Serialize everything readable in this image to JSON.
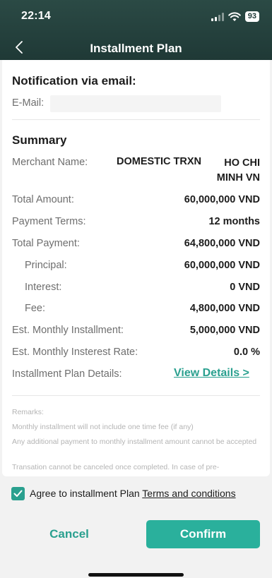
{
  "status_bar": {
    "time": "22:14",
    "battery": "93"
  },
  "header": {
    "title": "Installment Plan"
  },
  "notification": {
    "title": "Notification via email:",
    "email_label": "E-Mail:",
    "email_value": ""
  },
  "summary": {
    "title": "Summary",
    "merchant_label": "Merchant Name:",
    "merchant_value_a": "DOMESTIC TRXN",
    "merchant_value_b": "HO CHI MINH  VN",
    "rows": [
      {
        "label": "Total Amount:",
        "value": "60,000,000 VND"
      },
      {
        "label": "Payment Terms:",
        "value": "12 months"
      },
      {
        "label": "Total Payment:",
        "value": "64,800,000 VND"
      },
      {
        "label": "Principal:",
        "value": "60,000,000 VND"
      },
      {
        "label": "Interest:",
        "value": "0 VND"
      },
      {
        "label": "Fee:",
        "value": "4,800,000 VND"
      },
      {
        "label": "Est. Monthly Installment:",
        "value": "5,000,000 VND"
      },
      {
        "label": "Est. Monthly Insterest Rate:",
        "value": "0.0 %"
      }
    ],
    "details_label": "Installment Plan Details:",
    "details_link": "View Details >"
  },
  "remarks": {
    "title": "Remarks:",
    "lines": [
      "Monthly installment will not include one time fee (if any)",
      "Any additional payment to monthly installment amount cannot be accepted",
      "Transation cannot be canceled once completed. In case of pre-"
    ]
  },
  "footer": {
    "agree_text": "Agree to installment Plan ",
    "terms_link": "Terms and conditions",
    "agree_checked": true,
    "cancel_label": "Cancel",
    "confirm_label": "Confirm"
  },
  "colors": {
    "accent": "#2ab09c",
    "header": "#1f3936"
  }
}
